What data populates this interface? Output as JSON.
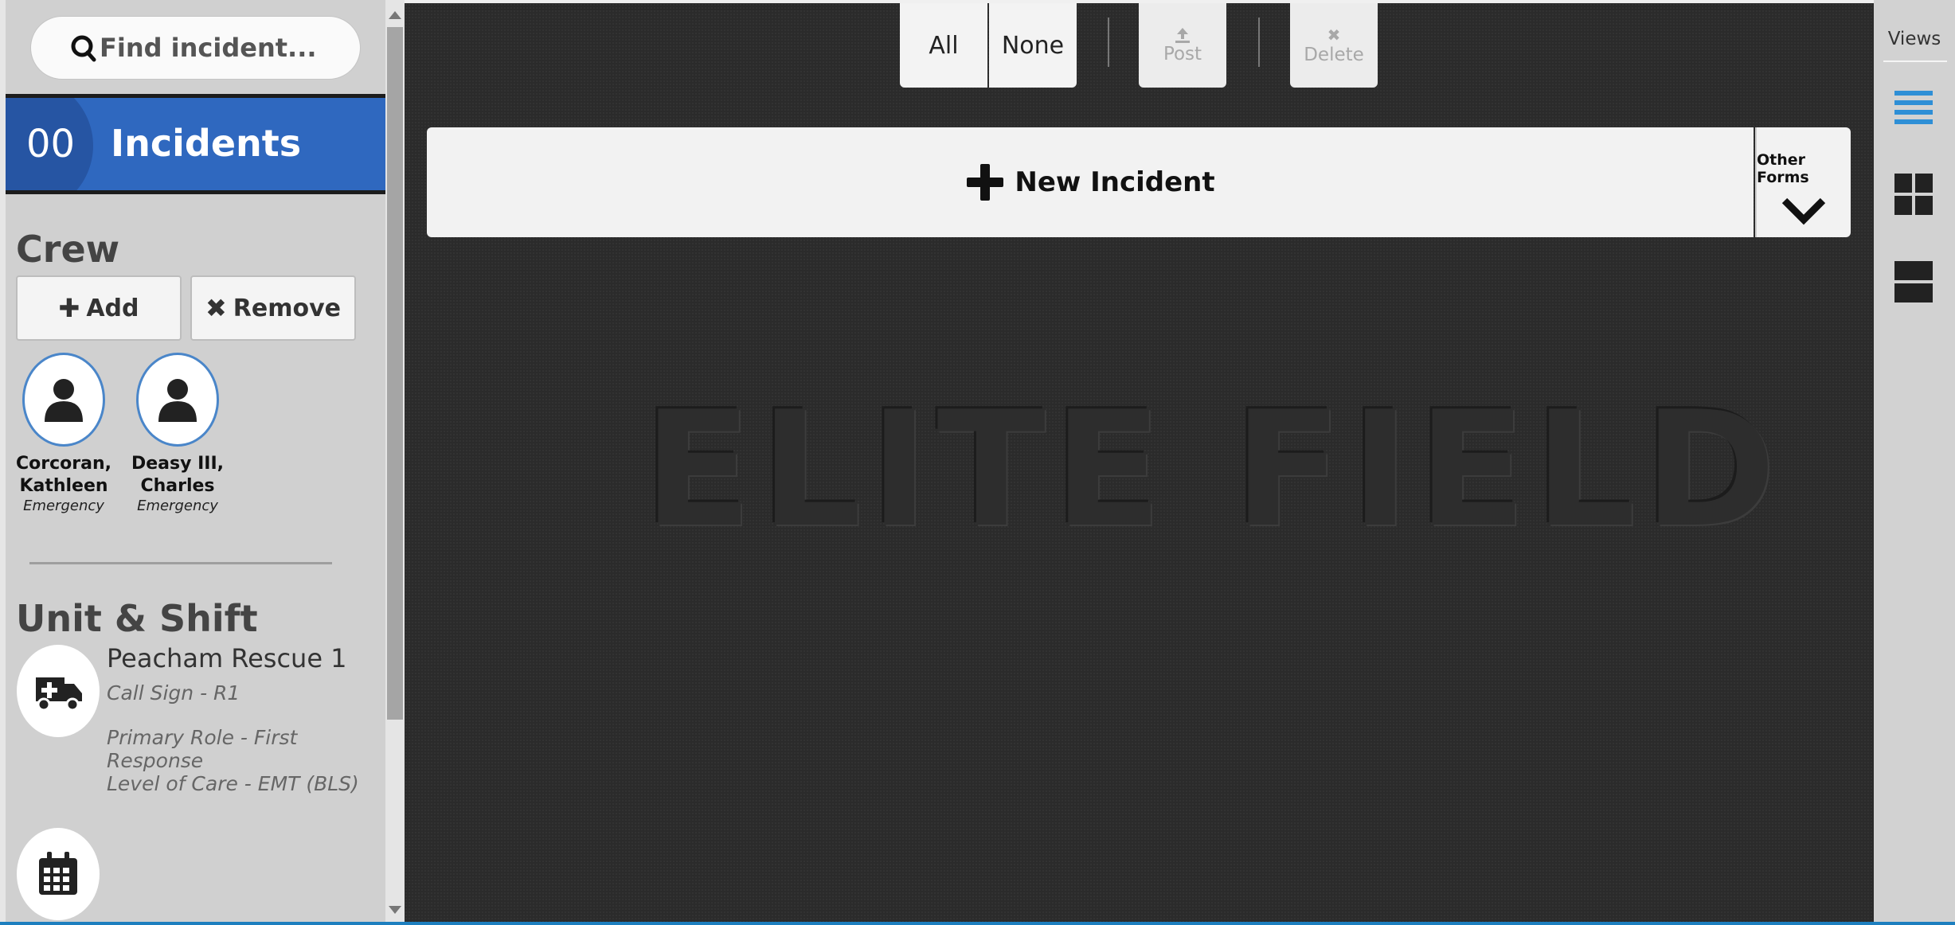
{
  "sidebar": {
    "search_placeholder": "Find incident...",
    "incidents": {
      "count": "00",
      "label": "Incidents"
    },
    "crew": {
      "title": "Crew",
      "add_label": "Add",
      "remove_label": "Remove",
      "members": [
        {
          "name_line1": "Corcoran,",
          "name_line2": "Kathleen",
          "role": "Emergency"
        },
        {
          "name_line1": "Deasy III,",
          "name_line2": "Charles",
          "role": "Emergency"
        }
      ]
    },
    "unit": {
      "title": "Unit & Shift",
      "name": "Peacham Rescue 1",
      "call_sign": "Call Sign - R1",
      "primary_role": "Primary Role - First Response",
      "level_of_care": "Level of Care - EMT (BLS)"
    }
  },
  "toolbar": {
    "all_label": "All",
    "none_label": "None",
    "post_label": "Post",
    "delete_label": "Delete"
  },
  "main": {
    "new_incident_label": "New Incident",
    "other_forms_label": "Other Forms",
    "watermark": "ELITE FIELD"
  },
  "views": {
    "title": "Views"
  },
  "colors": {
    "accent": "#2f68bf",
    "views_active": "#2e8fd6"
  }
}
